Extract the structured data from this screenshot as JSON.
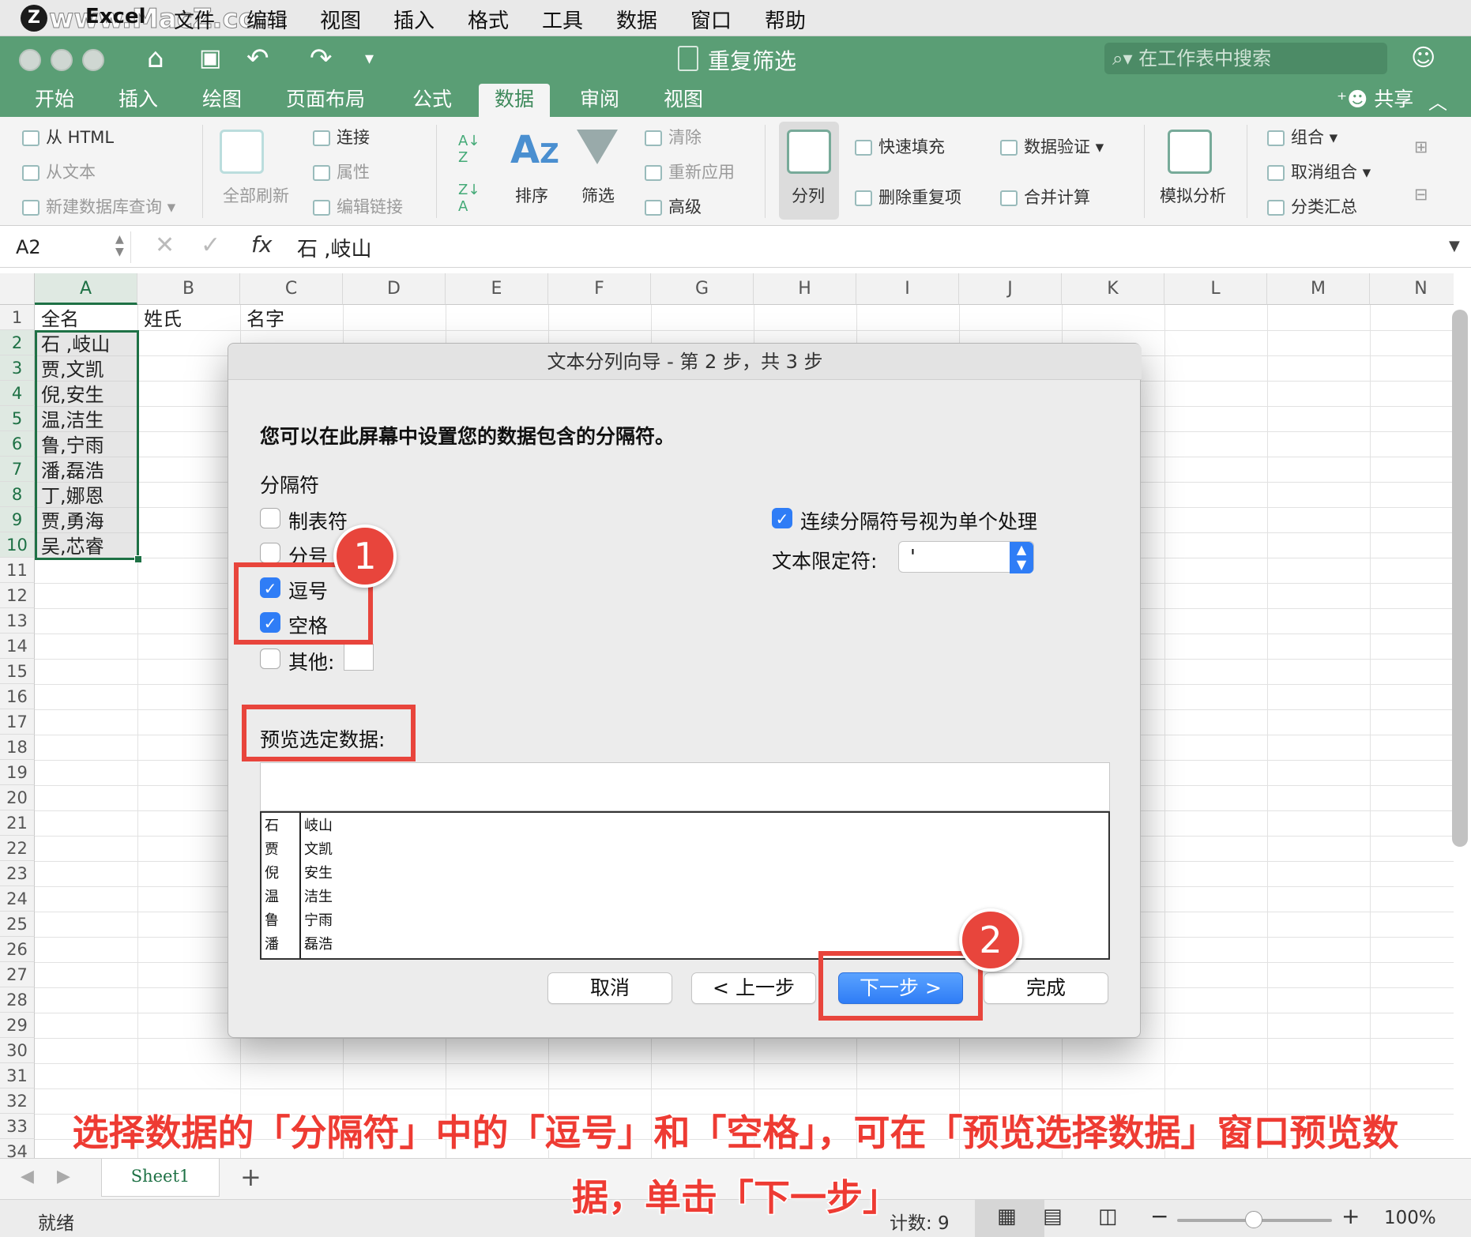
{
  "menubar": {
    "logo": "Z",
    "watermark": "www.MacZ.com",
    "items": [
      "Excel",
      "文件",
      "编辑",
      "视图",
      "插入",
      "格式",
      "工具",
      "数据",
      "窗口",
      "帮助"
    ]
  },
  "titlebar": {
    "doc_title": "重复筛选",
    "search_placeholder": "在工作表中搜索"
  },
  "ribbon_tabs": {
    "items": [
      "开始",
      "插入",
      "绘图",
      "页面布局",
      "公式",
      "数据",
      "审阅",
      "视图"
    ],
    "active": "数据",
    "share": "共享"
  },
  "ribbon": {
    "get_data": [
      "从 HTML",
      "从文本",
      "新建数据库查询"
    ],
    "refresh_all": "全部刷新",
    "connections": [
      "连接",
      "属性",
      "编辑链接"
    ],
    "sort": "排序",
    "filter": "筛选",
    "filter_opts": [
      "清除",
      "重新应用",
      "高级"
    ],
    "text_to_columns": "分列",
    "data_tools_1": [
      "快速填充",
      "删除重复项"
    ],
    "data_tools_2": [
      "数据验证",
      "合并计算"
    ],
    "what_if": "模拟分析",
    "outline": [
      "组合",
      "取消组合",
      "分类汇总"
    ]
  },
  "formula_bar": {
    "name_box": "A2",
    "fx": "fx",
    "value": "石 ,岐山"
  },
  "grid": {
    "columns": [
      "A",
      "B",
      "C",
      "D",
      "E",
      "F",
      "G",
      "H",
      "I",
      "J",
      "K",
      "L",
      "M",
      "N"
    ],
    "rows": [
      "1",
      "2",
      "3",
      "4",
      "5",
      "6",
      "7",
      "8",
      "9",
      "10",
      "11",
      "12",
      "13",
      "14",
      "15",
      "16",
      "17",
      "18",
      "19",
      "20",
      "21",
      "22",
      "23",
      "24",
      "25",
      "26",
      "27",
      "28",
      "29",
      "30",
      "31",
      "32",
      "33",
      "34"
    ],
    "headers": [
      "全名",
      "姓氏",
      "名字"
    ],
    "names": [
      "石 ,岐山",
      "贾,文凯",
      "倪,安生",
      "温,洁生",
      "鲁,宁雨",
      "潘,磊浩",
      "丁,娜恩",
      "贾,勇海",
      "吴,芯睿"
    ]
  },
  "dialog": {
    "title": "文本分列向导 - 第 2 步，共 3 步",
    "instruction": "您可以在此屏幕中设置您的数据包含的分隔符。",
    "delimiters_label": "分隔符",
    "tab": "制表符",
    "semicolon": "分号",
    "comma": "逗号",
    "space": "空格",
    "other": "其他:",
    "consecutive": "连续分隔符号视为单个处理",
    "qualifier_label": "文本限定符:",
    "qualifier_value": "'",
    "preview_label": "预览选定数据:",
    "preview_rows": [
      [
        "石",
        "岐山"
      ],
      [
        "贾",
        "文凯"
      ],
      [
        "倪",
        "安生"
      ],
      [
        "温",
        "洁生"
      ],
      [
        "鲁",
        "宁雨"
      ],
      [
        "潘",
        "磊浩"
      ]
    ],
    "cancel": "取消",
    "back": "< 上一步",
    "next": "下一步 >",
    "finish": "完成"
  },
  "annotations": {
    "badge1": "1",
    "badge2": "2",
    "caption_line1": "选择数据的「分隔符」中的「逗号」和「空格」，可在「预览选择数据」窗口预览数",
    "caption_line2": "据，单击「下一步」"
  },
  "sheetbar": {
    "sheet": "Sheet1",
    "add": "+"
  },
  "status": {
    "ready": "就绪",
    "count": "计数: 9",
    "zoom": "100%"
  },
  "colors": {
    "excel_green": "#5a9e75",
    "selection_green": "#1e7145",
    "annotation_red": "#e8453c",
    "primary_blue": "#2f7df6"
  }
}
